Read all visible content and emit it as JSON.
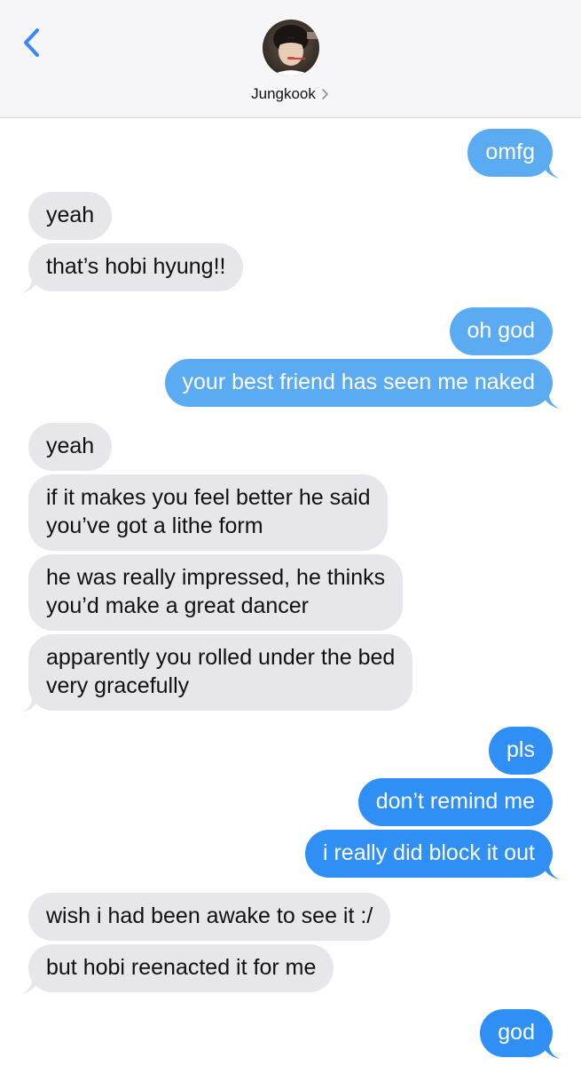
{
  "header": {
    "contact_name": "Jungkook",
    "back_icon": "chevron-left-icon",
    "disclosure_icon": "chevron-right-icon",
    "accent": "#3a86f7"
  },
  "colors": {
    "incoming_bubble": "#e6e6eb",
    "outgoing_bubble": "#5aabf2",
    "outgoing_bubble_dark": "#2f8ff5",
    "header_bg": "#f6f6f8"
  },
  "messages": [
    {
      "from": "me",
      "text": "omfg"
    },
    {
      "from": "them",
      "text": "yeah"
    },
    {
      "from": "them",
      "text": "that’s hobi hyung!!"
    },
    {
      "from": "me",
      "text": "oh god"
    },
    {
      "from": "me",
      "text": "your best friend has seen me naked"
    },
    {
      "from": "them",
      "text": "yeah"
    },
    {
      "from": "them",
      "lines": [
        "if it makes you feel better he said",
        "you’ve got a lithe form"
      ]
    },
    {
      "from": "them",
      "lines": [
        "he was really impressed, he thinks",
        "you’d make a great dancer"
      ]
    },
    {
      "from": "them",
      "lines": [
        "apparently you rolled under the bed",
        "very gracefully"
      ]
    },
    {
      "from": "me",
      "text": "pls"
    },
    {
      "from": "me",
      "text": "don’t remind me"
    },
    {
      "from": "me",
      "text": "i really did block it out"
    },
    {
      "from": "them",
      "text": "wish i had been awake to see it :/"
    },
    {
      "from": "them",
      "text": "but hobi reenacted it for me"
    },
    {
      "from": "me",
      "text": "god"
    }
  ]
}
